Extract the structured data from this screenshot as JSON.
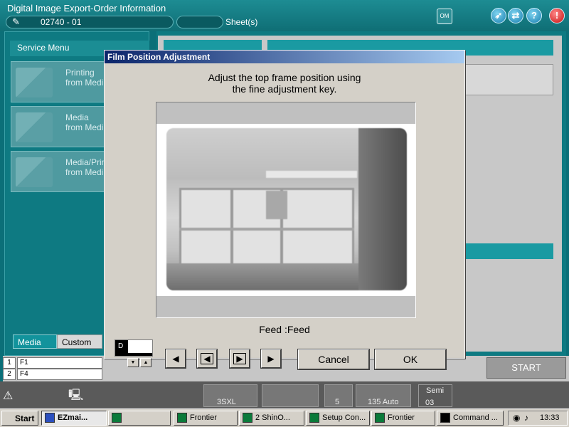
{
  "app": {
    "title": "Digital Image Export-Order Information",
    "order_number": "02740  - 01",
    "sheets_label": "Sheet(s)"
  },
  "header_icons": [
    "om-icon",
    "rocket-icon",
    "swap-icon",
    "help-icon",
    "warning-icon"
  ],
  "header_icon_glyphs": {
    "om": "OM",
    "rocket": "➶",
    "swap": "⇄",
    "help": "?",
    "warn": "!"
  },
  "service_menu": {
    "title": "Service Menu",
    "items": [
      {
        "label": "Printing\nfrom Medi"
      },
      {
        "label": "Media\nfrom Medi"
      },
      {
        "label": "Media/Prin\nfrom Medi"
      }
    ]
  },
  "tabs": {
    "media": "Media",
    "custom": "Custom"
  },
  "function_rows": [
    {
      "num": "1",
      "field": "F1"
    },
    {
      "num": "2",
      "field": "F4"
    }
  ],
  "start_button": "START",
  "status_bar": {
    "cells": [
      "3SXL",
      "5",
      "135 Auto",
      "Semi",
      "03"
    ]
  },
  "dialog": {
    "title": "Film Position Adjustment",
    "message_line1": "Adjust the top frame position using",
    "message_line2": "the fine adjustment key.",
    "feed_label": "Feed :Feed",
    "d_label": "D",
    "nav_buttons": [
      "◀",
      "◀",
      "▶",
      "▶"
    ],
    "cancel_label": "Cancel",
    "ok_label": "OK"
  },
  "taskbar": {
    "start_label": "Start",
    "tasks": [
      {
        "label": "EZmai..."
      },
      {
        "label": ""
      },
      {
        "label": "Frontier"
      },
      {
        "label": "2 ShinO..."
      },
      {
        "label": "Setup Con..."
      },
      {
        "label": "Frontier"
      },
      {
        "label": "Command ..."
      }
    ],
    "clock": "13:33"
  }
}
